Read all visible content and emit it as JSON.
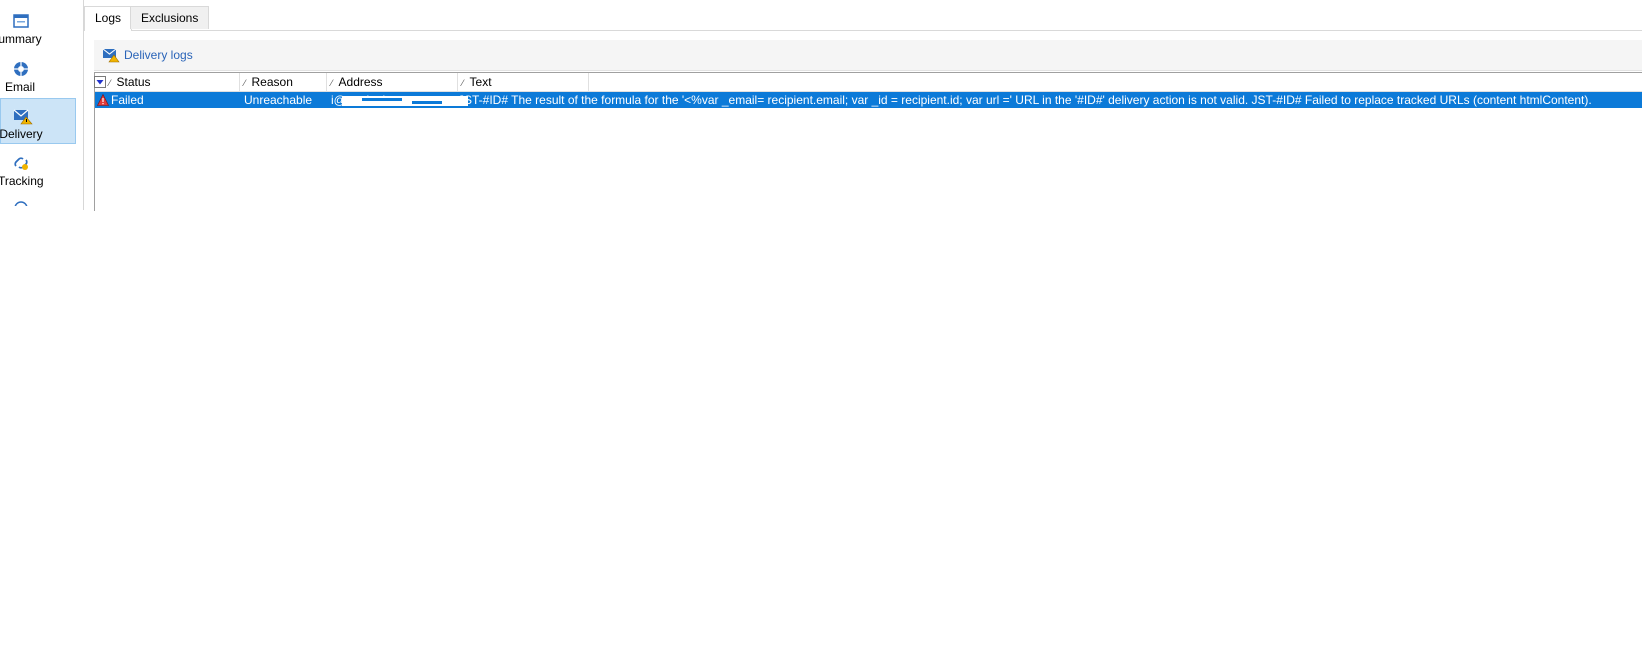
{
  "sidebar": {
    "items": [
      {
        "label": "ummary",
        "icon": "summary-icon"
      },
      {
        "label": "Email",
        "icon": "email-icon"
      },
      {
        "label": "Delivery",
        "icon": "delivery-icon",
        "selected": true
      },
      {
        "label": "Tracking",
        "icon": "tracking-icon"
      }
    ]
  },
  "tabs": [
    {
      "label": "Logs",
      "active": true
    },
    {
      "label": "Exclusions",
      "active": false
    }
  ],
  "toolbar": {
    "delivery_logs_label": "Delivery logs"
  },
  "grid": {
    "columns": [
      "Status",
      "Reason",
      "Address",
      "Text"
    ],
    "rows": [
      {
        "status": "Failed",
        "reason": "Unreachable",
        "address": "i@markatin",
        "text": "JST-#ID# The result of the formula for the '<%var _email= recipient.email; var _id = recipient.id; var url =' URL in the '#ID#' delivery action is not valid. JST-#ID# Failed to replace tracked URLs (content htmlContent)."
      }
    ]
  },
  "colors": {
    "selection": "#0c7ad8",
    "link": "#2a64b8",
    "nav_selected": "#cce4f7"
  }
}
